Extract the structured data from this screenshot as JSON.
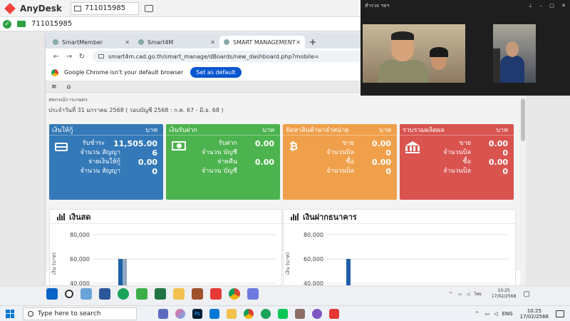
{
  "anydesk": {
    "app_name": "AnyDesk",
    "tab_label": "711015985",
    "address_value": "711015985"
  },
  "browser": {
    "tabs": [
      {
        "label": "SmartMember"
      },
      {
        "label": "Smart4M"
      },
      {
        "label": "SMART MANAGEMENT"
      }
    ],
    "new_tab": "+",
    "url": "smart4m.cad.go.th/smart_manage/dBoards/new_dashboard.php?mobile=",
    "infobar_text": "Google Chrome isn't your default browser",
    "infobar_button": "Set as default"
  },
  "app": {
    "nav_menu_icon": "≡",
    "nav_home_icon": "⌂",
    "user_label": "สหกรณ์การเกษตร",
    "date_line": "ประจำวันที่ 31 มกราคม 2568 ( รอบบัญชี 2568 : ก.ค. 67 - มิ.ย. 68 )"
  },
  "cards": [
    {
      "title": "เงินให้กู้",
      "unit": "บาท",
      "color": "#3479b8",
      "icon": "credit-card-icon",
      "rows": [
        {
          "label": "รับชำระ",
          "value": "11,505.00"
        },
        {
          "label": "จำนวน สัญญา",
          "value": "6"
        },
        {
          "label": "จ่ายเงินให้กู้",
          "value": "0.00"
        },
        {
          "label": "จำนวน สัญญา",
          "value": "0"
        }
      ]
    },
    {
      "title": "เงินรับฝาก",
      "unit": "บาท",
      "color": "#4cb34e",
      "icon": "cash-icon",
      "rows": [
        {
          "label": "รับฝาก",
          "value": "0.00"
        },
        {
          "label": "จำนวน บัญชี",
          "value": ""
        },
        {
          "label": "จ่ายคืน",
          "value": "0.00"
        },
        {
          "label": "จำนวน บัญชี",
          "value": ""
        }
      ]
    },
    {
      "title": "จัดหาสินค้ามาจำหน่าย",
      "unit": "บาท",
      "color": "#f0a04b",
      "icon": "bitcoin-icon",
      "rows": [
        {
          "label": "ขาย",
          "value": "0.00"
        },
        {
          "label": "จำนวนบิล",
          "value": "0"
        },
        {
          "label": "ซื้อ",
          "value": "0.00"
        },
        {
          "label": "จำนวนบิล",
          "value": "0"
        }
      ]
    },
    {
      "title": "รวบรวมผลิตผล",
      "unit": "บาท",
      "color": "#d9534f",
      "icon": "bank-icon",
      "rows": [
        {
          "label": "ขาย",
          "value": "0.00"
        },
        {
          "label": "จำนวนบิล",
          "value": "0"
        },
        {
          "label": "ซื้อ",
          "value": "0.00"
        },
        {
          "label": "จำนวนบิล",
          "value": "0"
        }
      ]
    }
  ],
  "chart_data": [
    {
      "type": "bar",
      "title": "เงินสด",
      "ylabel": "เงิน (บาท)",
      "y_ticks": [
        "80,000",
        "60,000",
        "40,000"
      ],
      "ylim": [
        40000,
        80000
      ],
      "series": [
        {
          "values": [
            60000
          ],
          "color": "#1f5fa6"
        },
        {
          "values": [
            60000
          ],
          "color": "#8fa8c0"
        }
      ]
    },
    {
      "type": "bar",
      "title": "เงินฝากธนาคาร",
      "ylabel": "เงิน (บาท)",
      "y_ticks": [
        "80,000",
        "60,000",
        "40,000"
      ],
      "ylim": [
        40000,
        80000
      ],
      "series": [
        {
          "values": [
            60000
          ],
          "color": "#1f5fa6"
        }
      ]
    }
  ],
  "video": {
    "name": "สำรวจ ฯลฯ"
  },
  "inner_taskbar": {
    "lang": "ไทย",
    "time": "10:25",
    "date": "17/02/2568"
  },
  "taskbar": {
    "search_placeholder": "Type here to search",
    "lang": "ENG",
    "time": "10:25",
    "date": "17/02/2568"
  }
}
